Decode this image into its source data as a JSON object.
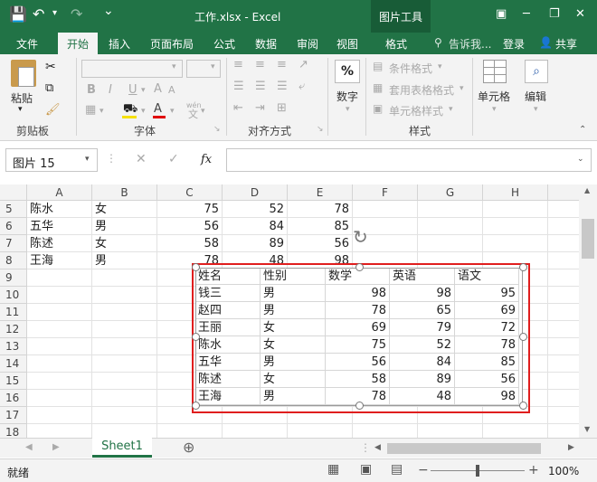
{
  "titlebar": {
    "title": "工作.xlsx - Excel",
    "context_group": "图片工具",
    "qa_save": "💾",
    "qa_undo": "↶",
    "qa_redo": "↷",
    "qa_customize": "⌄"
  },
  "tabs": [
    {
      "label": "文件"
    },
    {
      "label": "开始"
    },
    {
      "label": "插入"
    },
    {
      "label": "页面布局"
    },
    {
      "label": "公式"
    },
    {
      "label": "数据"
    },
    {
      "label": "审阅"
    },
    {
      "label": "视图"
    },
    {
      "label": "格式"
    }
  ],
  "tellme": "告诉我...",
  "login": "登录",
  "share": "共享",
  "ribbon": {
    "paste": "粘贴",
    "groups": {
      "clipboard": "剪贴板",
      "font": "字体",
      "alignment": "对齐方式",
      "styles": "样式"
    },
    "number": "数字",
    "number_icon": "%",
    "cond_format": "条件格式",
    "table_format": "套用表格格式",
    "cell_style": "单元格样式",
    "cells": "单元格",
    "editing": "编辑",
    "bold": "B",
    "italic": "I",
    "underline": "U",
    "font_grow": "A",
    "font_shrink": "A",
    "wen": "wén"
  },
  "formula_bar": {
    "name_box": "图片 15",
    "fx": "fx",
    "value": ""
  },
  "grid": {
    "columns": [
      "A",
      "B",
      "C",
      "D",
      "E",
      "F",
      "G",
      "H"
    ],
    "rows": [
      "5",
      "6",
      "7",
      "8",
      "9",
      "10",
      "11",
      "12",
      "13",
      "14",
      "15",
      "16",
      "17",
      "18"
    ],
    "data": [
      [
        "陈水",
        "女",
        "75",
        "52",
        "78"
      ],
      [
        "五华",
        "男",
        "56",
        "84",
        "85"
      ],
      [
        "陈述",
        "女",
        "58",
        "89",
        "56"
      ],
      [
        "王海",
        "男",
        "78",
        "48",
        "98"
      ]
    ]
  },
  "picture": {
    "headers": [
      "姓名",
      "性别",
      "数学",
      "英语",
      "语文"
    ],
    "rows": [
      [
        "钱三",
        "男",
        "98",
        "98",
        "95"
      ],
      [
        "赵四",
        "男",
        "78",
        "65",
        "69"
      ],
      [
        "王丽",
        "女",
        "69",
        "79",
        "72"
      ],
      [
        "陈水",
        "女",
        "75",
        "52",
        "78"
      ],
      [
        "五华",
        "男",
        "56",
        "84",
        "85"
      ],
      [
        "陈述",
        "女",
        "58",
        "89",
        "56"
      ],
      [
        "王海",
        "男",
        "78",
        "48",
        "98"
      ]
    ]
  },
  "sheet": {
    "tab": "Sheet1",
    "add": "⊕"
  },
  "status": {
    "ready": "就绪",
    "zoom": "100%",
    "minus": "−",
    "plus": "+"
  },
  "colors": {
    "excel_green": "#217346",
    "selection_red": "#e01e1e"
  }
}
